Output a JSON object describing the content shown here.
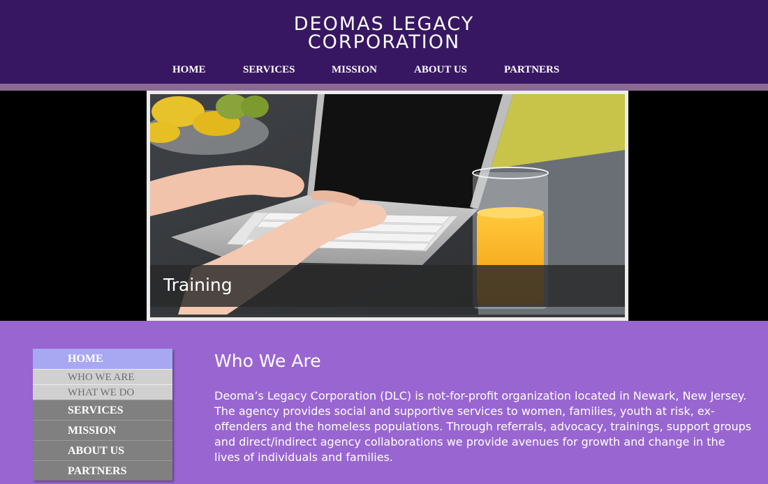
{
  "header": {
    "logo_line1": "DEOMAS LEGACY",
    "logo_line2": "CORPORATION",
    "nav": [
      "HOME",
      "SERVICES",
      "MISSION",
      "ABOUT US",
      "PARTNERS"
    ]
  },
  "banner": {
    "caption": "Training"
  },
  "sidebar": {
    "items": [
      {
        "label": "HOME",
        "state": "active"
      },
      {
        "label": "WHO WE ARE",
        "state": "sub"
      },
      {
        "label": "WHAT WE DO",
        "state": "sub"
      },
      {
        "label": "SERVICES",
        "state": "main"
      },
      {
        "label": "MISSION",
        "state": "main"
      },
      {
        "label": "ABOUT US",
        "state": "main"
      },
      {
        "label": "PARTNERS",
        "state": "main"
      }
    ]
  },
  "content": {
    "heading": "Who We Are",
    "paragraph": "Deoma’s Legacy Corporation (DLC) is not-for-profit organization located in Newark, New Jersey. The agency provides social and supportive services to women, families, youth at risk, ex-offenders and the homeless populations. Through referrals, advocacy, trainings, support groups and direct/indirect agency collaborations we provide avenues for growth and change in the lives of individuals and families."
  },
  "colors": {
    "header_bg": "#371762",
    "stripe": "#8a6a93",
    "page_bg": "#9966d1",
    "sidebar_active": "#a8a8f2",
    "sidebar_main": "#808080",
    "sidebar_sub": "#d0d0d0"
  }
}
